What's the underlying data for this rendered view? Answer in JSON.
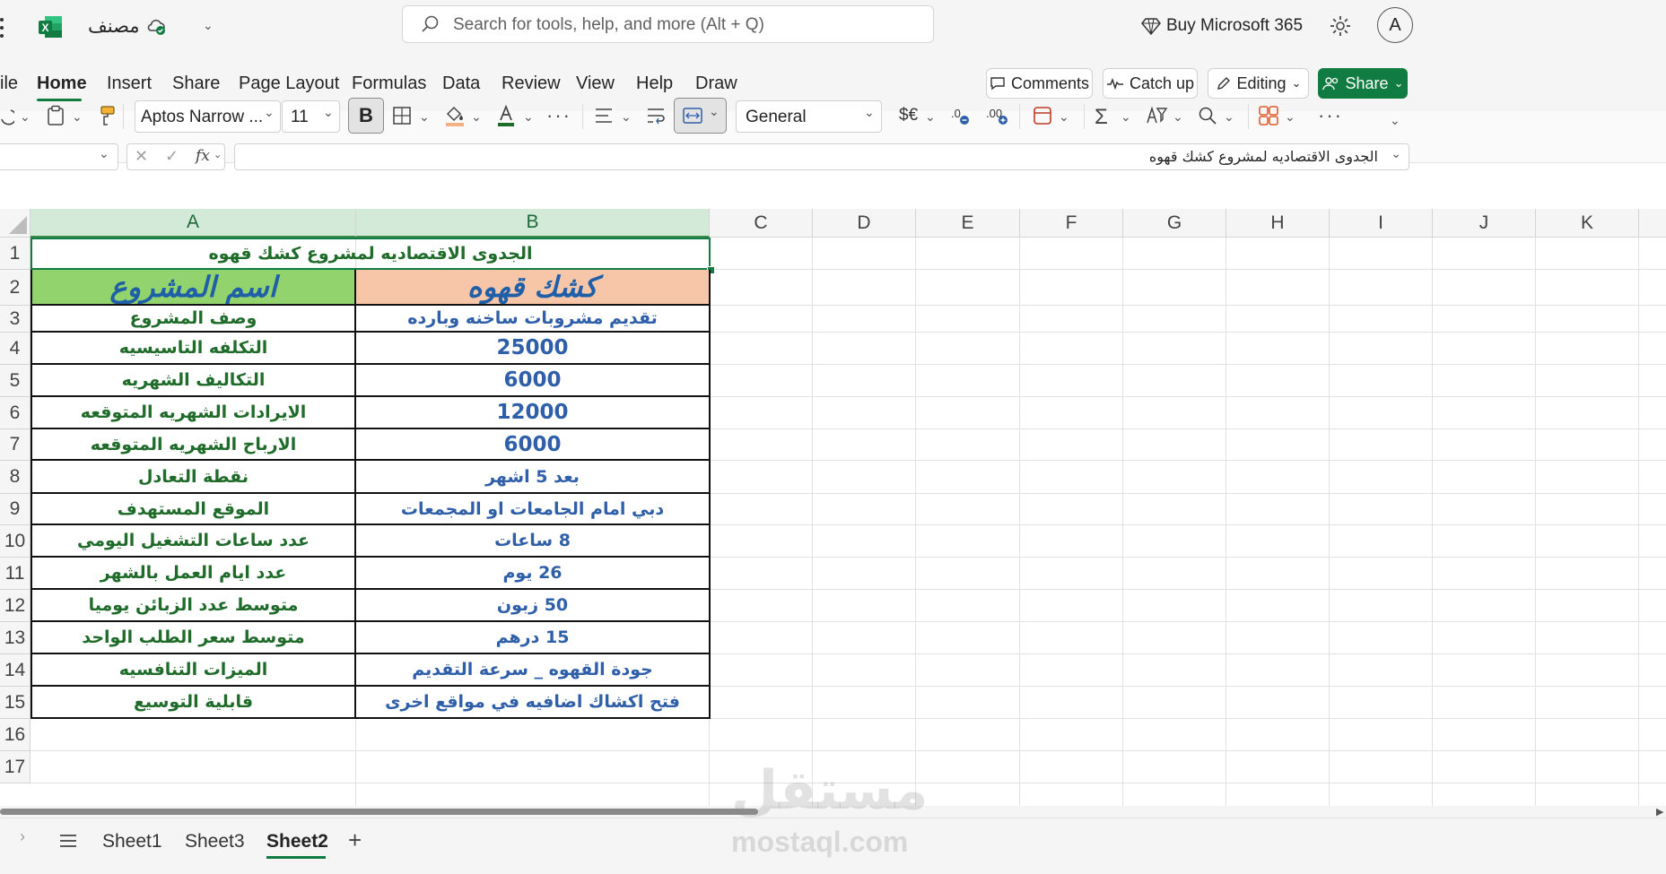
{
  "titlebar": {
    "workbook_name": "مصنف",
    "search_placeholder": "Search for tools, help, and more (Alt + Q)",
    "buy_label": "Buy Microsoft 365",
    "avatar_initial": "A"
  },
  "menu": {
    "tabs": [
      "ile",
      "Home",
      "Insert",
      "Share",
      "Page Layout",
      "Formulas",
      "Data",
      "Review",
      "View",
      "Help",
      "Draw"
    ],
    "active_tab": "Home",
    "comments_label": "Comments",
    "catchup_label": "Catch up",
    "editing_label": "Editing",
    "share_label": "Share"
  },
  "ribbon": {
    "font_name": "Aptos Narrow ...",
    "font_size": "11",
    "bold_label": "B",
    "number_format": "General",
    "currency_label": "$€"
  },
  "formula_bar": {
    "fx_label": "fx",
    "content": "الجدوى الاقتصاديه لمشروع كشك قهوه"
  },
  "sheet": {
    "columns": [
      "A",
      "B",
      "C",
      "D",
      "E",
      "F",
      "G",
      "H",
      "I",
      "J",
      "K"
    ],
    "rows": [
      "1",
      "2",
      "3",
      "4",
      "5",
      "6",
      "7",
      "8",
      "9",
      "10",
      "11",
      "12",
      "13",
      "14",
      "15",
      "16",
      "17"
    ],
    "title": "الجدوى الاقتصاديه لمشروع كشك قهوه",
    "header_a": "اسم المشروع",
    "header_b": "كشك قهوه",
    "table": [
      {
        "a": "وصف المشروع",
        "b": "تقديم مشروبات ساخنه وبارده"
      },
      {
        "a": "التكلفه التاسيسيه",
        "b": "25000"
      },
      {
        "a": "التكاليف الشهريه",
        "b": "6000"
      },
      {
        "a": "الايرادات الشهريه المتوقعه",
        "b": "12000"
      },
      {
        "a": "الارباح الشهريه المتوقعه",
        "b": "6000"
      },
      {
        "a": "نقطة التعادل",
        "b": "بعد 5 اشهر"
      },
      {
        "a": "الموقع المستهدف",
        "b": "دبي امام الجامعات او المجمعات"
      },
      {
        "a": "عدد ساعات التشغيل اليومي",
        "b": "8 ساعات"
      },
      {
        "a": "عدد ايام العمل بالشهر",
        "b": "26 يوم"
      },
      {
        "a": "متوسط عدد الزبائن يوميا",
        "b": "50 زبون"
      },
      {
        "a": "متوسط سعر الطلب الواحد",
        "b": "15 درهم"
      },
      {
        "a": "الميزات التنافسيه",
        "b": "جودة القهوه _ سرعة التقديم"
      },
      {
        "a": "قابلية التوسيع",
        "b": "فتح اكشاك اضافيه في مواقع اخرى"
      }
    ]
  },
  "sheet_tabs": [
    "Sheet1",
    "Sheet3",
    "Sheet2"
  ],
  "active_sheet": "Sheet2",
  "watermark": {
    "arabic": "مستقل",
    "latin": "mostaql.com"
  },
  "colors": {
    "excel_green": "#107c41",
    "header_a_bg": "#92d36e",
    "header_b_bg": "#f7c6a8",
    "text_green": "#1f6b2a",
    "text_blue": "#2e5fa8"
  }
}
